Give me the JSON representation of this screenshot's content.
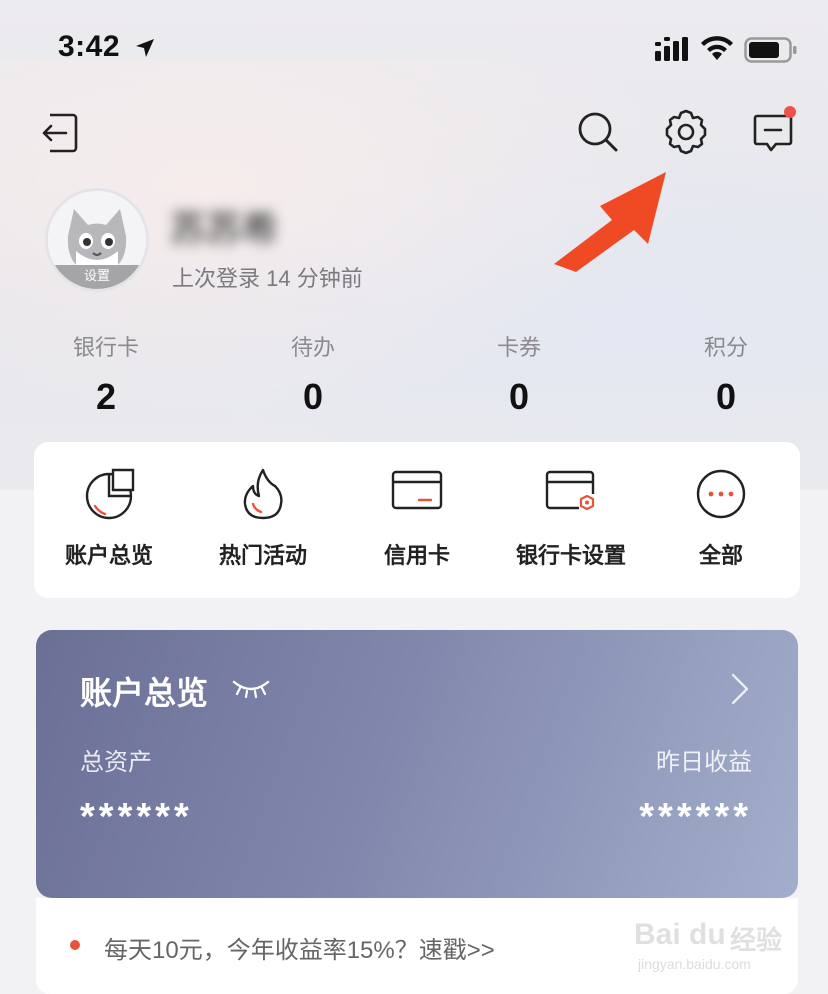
{
  "status_bar": {
    "time": "3:42"
  },
  "profile": {
    "username": "苏苏希",
    "avatar_tag": "设置",
    "last_login": "上次登录 14 分钟前"
  },
  "stats": [
    {
      "label": "银行卡",
      "value": "2"
    },
    {
      "label": "待办",
      "value": "0"
    },
    {
      "label": "卡券",
      "value": "0"
    },
    {
      "label": "积分",
      "value": "0"
    }
  ],
  "shortcuts": [
    {
      "label": "账户总览",
      "icon": "pie-chart-icon"
    },
    {
      "label": "热门活动",
      "icon": "flame-icon"
    },
    {
      "label": "信用卡",
      "icon": "credit-card-icon"
    },
    {
      "label": "银行卡设置",
      "icon": "card-settings-icon"
    },
    {
      "label": "全部",
      "icon": "more-icon"
    }
  ],
  "asset_card": {
    "title": "账户总览",
    "total_label": "总资产",
    "total_value": "******",
    "yesterday_label": "昨日收益",
    "yesterday_value": "******"
  },
  "promo": {
    "text": "每天10元，今年收益率15%？速戳>>"
  },
  "watermark": {
    "logo": "Bai du",
    "cn": "经验",
    "url": "jingyan.baidu.com"
  },
  "colors": {
    "accent": "#e8543a",
    "arrow": "#f04a24",
    "card_start": "#6b6f96",
    "card_end": "#a2aecb"
  }
}
